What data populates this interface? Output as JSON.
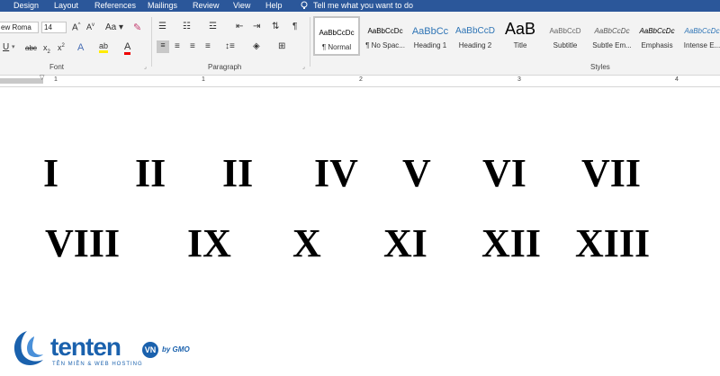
{
  "tabs": [
    "Design",
    "Layout",
    "References",
    "Mailings",
    "Review",
    "View",
    "Help"
  ],
  "tell_me": "Tell me what you want to do",
  "font": {
    "name": "ew Roma",
    "size": "14",
    "group_label": "Font"
  },
  "paragraph": {
    "group_label": "Paragraph"
  },
  "styles": {
    "group_label": "Styles",
    "items": [
      {
        "preview": "AaBbCcDc",
        "name": "¶ Normal"
      },
      {
        "preview": "AaBbCcDc",
        "name": "¶ No Spac..."
      },
      {
        "preview": "AaBbCc",
        "name": "Heading 1"
      },
      {
        "preview": "AaBbCcD",
        "name": "Heading 2"
      },
      {
        "preview": "AaB",
        "name": "Title"
      },
      {
        "preview": "AaBbCcD",
        "name": "Subtitle"
      },
      {
        "preview": "AaBbCcDc",
        "name": "Subtle Em..."
      },
      {
        "preview": "AaBbCcDc",
        "name": "Emphasis"
      },
      {
        "preview": "AaBbCcDc",
        "name": "Intense E..."
      }
    ]
  },
  "ruler_numbers": [
    "1",
    "1",
    "2",
    "3",
    "4"
  ],
  "numerals": [
    "I",
    "II",
    "II",
    "IV",
    "V",
    "VI",
    "VII",
    "VIII",
    "IX",
    "X",
    "XI",
    "XII",
    "XIII"
  ],
  "logo": {
    "brand": "tenten",
    "tld": "VN",
    "by": "by GMO",
    "tagline": "TÊN MIỀN & WEB HOSTING"
  },
  "colors": {
    "ribbon_blue": "#2b579a",
    "logo_blue": "#1a61ad"
  }
}
